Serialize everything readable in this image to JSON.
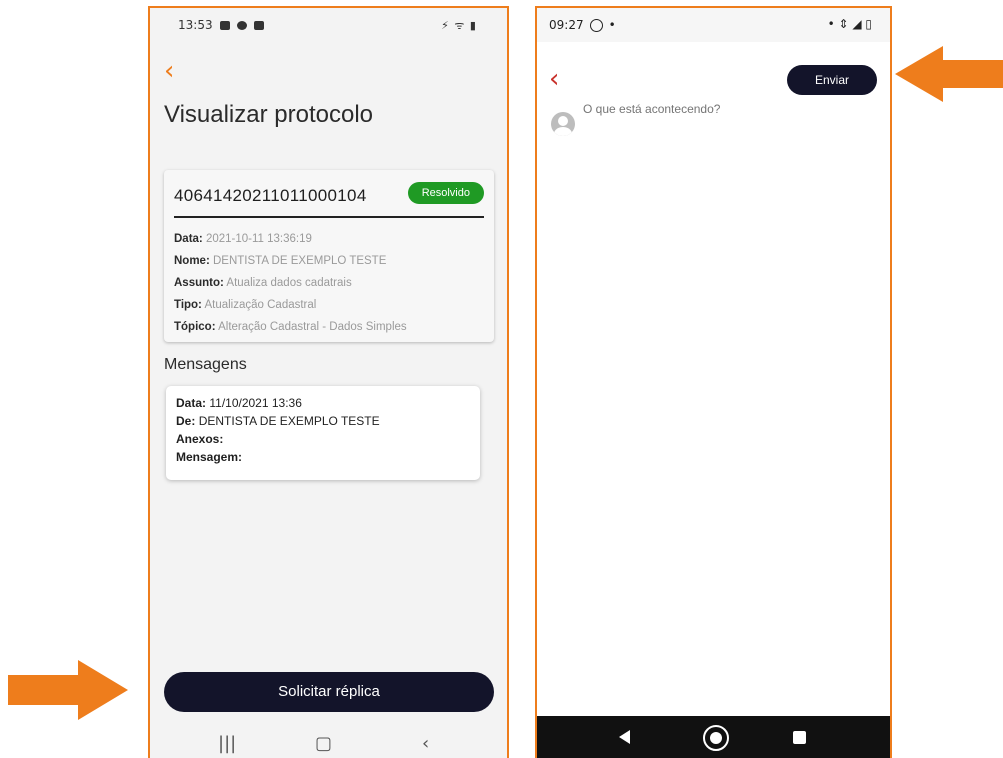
{
  "phone1": {
    "status_time": "13:53",
    "status_right": "⚡ ᯤ ▮",
    "back_icon": "‹",
    "title": "Visualizar protocolo",
    "protocol_number": "40641420211011000104",
    "status_badge": "Resolvido",
    "fields": [
      {
        "label": "Data:",
        "value": "2021-10-11 13:36:19"
      },
      {
        "label": "Nome:",
        "value": "DENTISTA DE EXEMPLO TESTE"
      },
      {
        "label": "Assunto:",
        "value": "Atualiza dados cadatrais"
      },
      {
        "label": "Tipo:",
        "value": "Atualização Cadastral"
      },
      {
        "label": "Tópico:",
        "value": "Alteração Cadastral - Dados Simples"
      }
    ],
    "messages_title": "Mensagens",
    "message": {
      "date_label": "Data:",
      "date_value": "11/10/2021 13:36",
      "from_label": "De:",
      "from_value": "DENTISTA DE EXEMPLO TESTE",
      "attachments_label": "Anexos:",
      "message_label": "Mensagem:"
    },
    "reply_button": "Solicitar réplica",
    "nav": {
      "recent": "|||",
      "home": "▢",
      "back": "‹"
    }
  },
  "phone2": {
    "status_time": "09:27",
    "status_dot": "•",
    "status_right": "• ⇕ ◢ ▯",
    "back_icon": "‹",
    "send_button": "Enviar",
    "compose_placeholder": "O que está acontecendo?"
  },
  "colors": {
    "accent": "#ee7d1c",
    "dark_button": "#13142a",
    "badge_green": "#1f9a24",
    "back_red": "#c8302a"
  },
  "icons": [
    "back-chevron-icon",
    "whatsapp-icon",
    "avatar-icon",
    "nav-back-icon",
    "nav-home-icon",
    "nav-recent-icon",
    "arrow-right-icon",
    "arrow-left-icon"
  ]
}
